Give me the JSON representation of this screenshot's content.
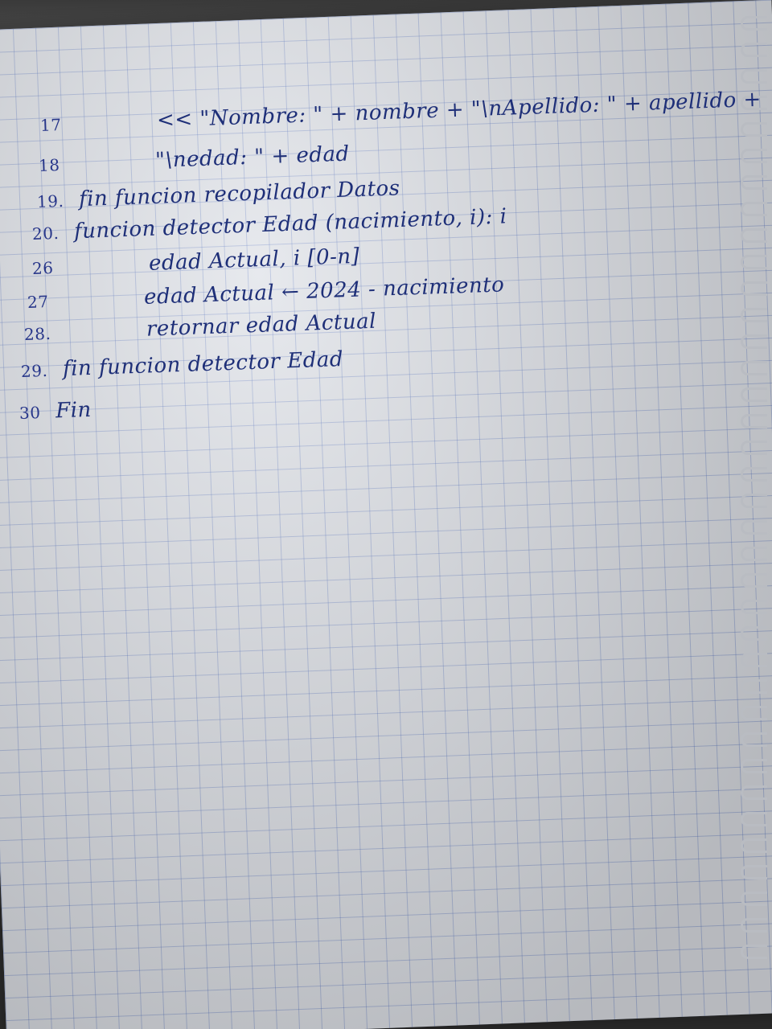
{
  "notebook": {
    "lines": [
      {
        "num": "17",
        "text": "<< \"Nombre: \" + nombre + \"\\nApellido: \" + apellido +"
      },
      {
        "num": "18",
        "text": "\"\\nedad: \" + edad"
      },
      {
        "num": "19.",
        "text": "fin funcion recopilador Datos"
      },
      {
        "num": "20.",
        "text": "funcion detector Edad (nacimiento, i): i"
      },
      {
        "num": "26",
        "text": "edad Actual, i [0-n]"
      },
      {
        "num": "27",
        "text": "edad Actual ← 2024 - nacimiento"
      },
      {
        "num": "28.",
        "text": "retornar edad Actual"
      },
      {
        "num": "29.",
        "text": "fin funcion detector Edad"
      },
      {
        "num": "30",
        "text": "Fin"
      }
    ]
  },
  "colors": {
    "ink": "#1e2f78",
    "paper": "#dfe2e8",
    "grid": "#506ebe"
  }
}
